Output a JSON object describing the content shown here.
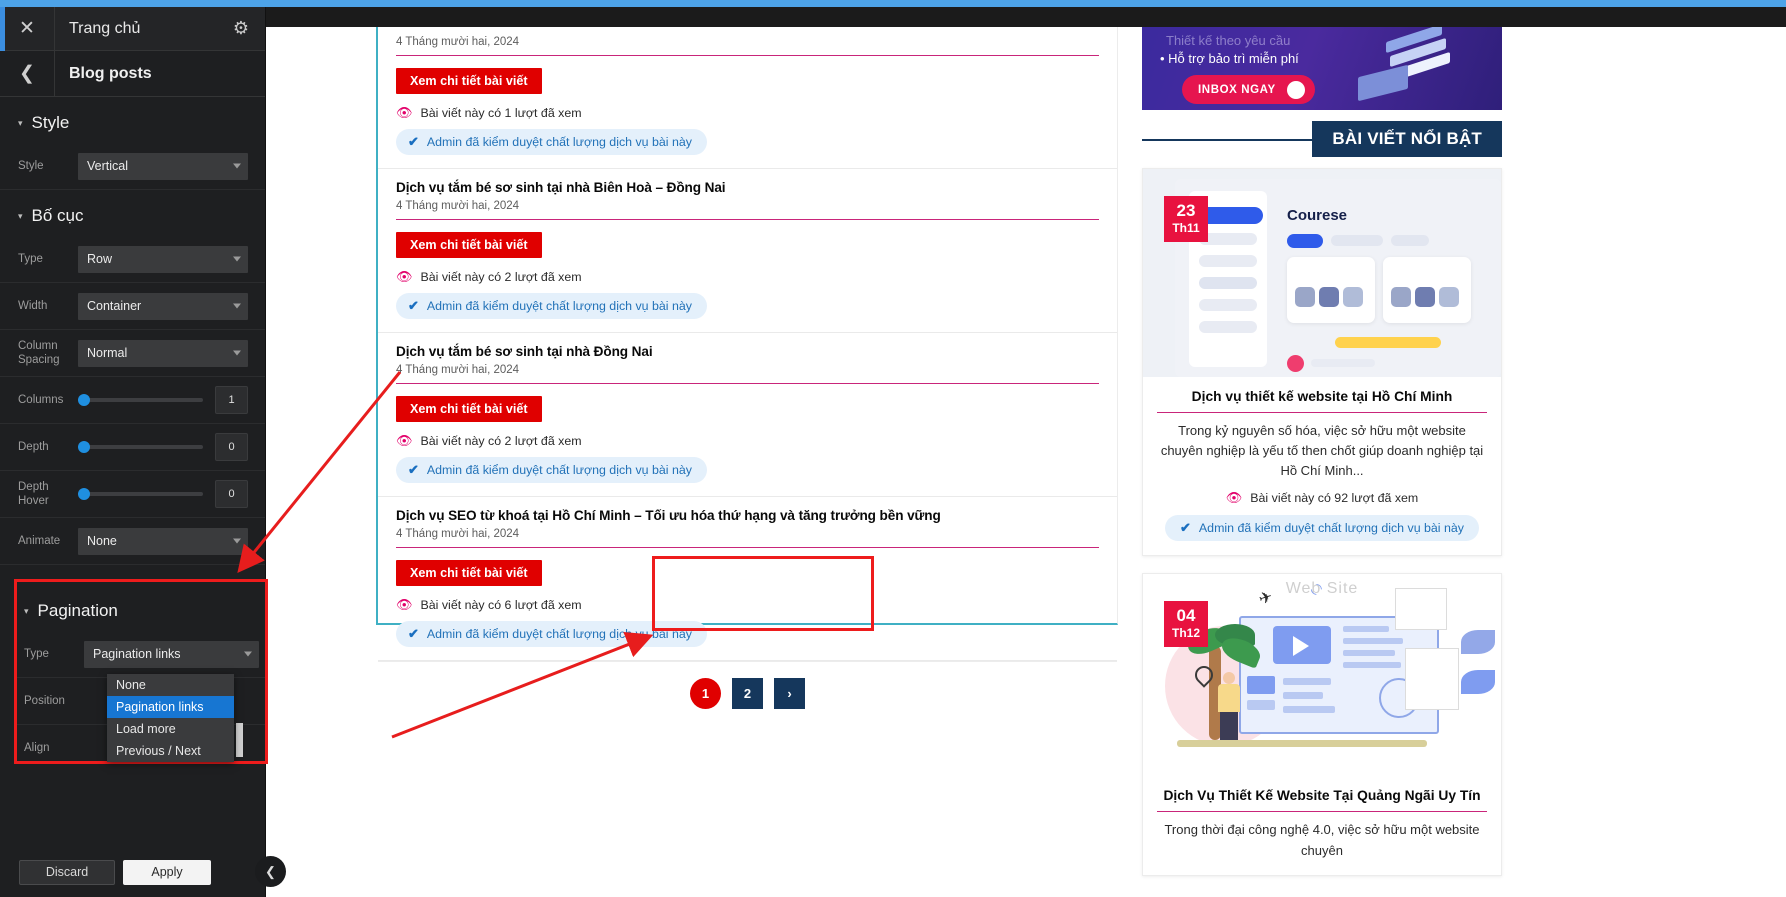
{
  "editor": {
    "close_icon": "✕",
    "home_title": "Trang chủ",
    "gear_icon": "⚙",
    "back_icon": "❮",
    "panel_title": "Blog posts",
    "sections": [
      {
        "name": "Style",
        "caret": "▾",
        "fields": [
          {
            "label": "Style",
            "type": "select",
            "value": "Vertical"
          }
        ]
      },
      {
        "name": "Bố cục",
        "caret": "▾",
        "fields": [
          {
            "label": "Type",
            "type": "select",
            "value": "Row"
          },
          {
            "label": "Width",
            "type": "select",
            "value": "Container"
          },
          {
            "label": "Column Spacing",
            "type": "select",
            "value": "Normal"
          },
          {
            "label": "Columns",
            "type": "slider",
            "value": "1"
          },
          {
            "label": "Depth",
            "type": "slider",
            "value": "0"
          },
          {
            "label": "Depth Hover",
            "type": "slider",
            "value": "0"
          },
          {
            "label": "Animate",
            "type": "select",
            "value": "None"
          }
        ]
      }
    ],
    "pagination": {
      "caret": "▾",
      "title": "Pagination",
      "type_label": "Type",
      "type_value": "Pagination links",
      "position_label": "Position",
      "align_label": "Align",
      "options": [
        {
          "label": "None",
          "selected": false
        },
        {
          "label": "Pagination links",
          "selected": true
        },
        {
          "label": "Load more",
          "selected": false
        },
        {
          "label": "Previous / Next",
          "selected": false
        }
      ]
    },
    "footer": {
      "discard": "Discard",
      "apply": "Apply",
      "collapse_icon": "❮"
    }
  },
  "content": {
    "posts": [
      {
        "title": "",
        "title_clipped": true,
        "date": "4 Tháng mười hai, 2024",
        "button": "Xem chi tiết bài viết",
        "views": "Bài viết này có 1 lượt đã xem",
        "admin": "Admin đã kiểm duyệt chất lượng dịch vụ bài này"
      },
      {
        "title": "Dịch vụ tắm bé sơ sinh tại nhà Biên Hoà – Đồng Nai",
        "title_clipped": false,
        "date": "4 Tháng mười hai, 2024",
        "button": "Xem chi tiết bài viết",
        "views": "Bài viết này có 2 lượt đã xem",
        "admin": "Admin đã kiểm duyệt chất lượng dịch vụ bài này"
      },
      {
        "title": "Dịch vụ tắm bé sơ sinh tại nhà Đồng Nai",
        "title_clipped": false,
        "date": "4 Tháng mười hai, 2024",
        "button": "Xem chi tiết bài viết",
        "views": "Bài viết này có 2 lượt đã xem",
        "admin": "Admin đã kiểm duyệt chất lượng dịch vụ bài này"
      },
      {
        "title": "Dịch vụ SEO từ khoá tại Hồ Chí Minh – Tối ưu hóa thứ hạng và tăng trưởng bền vững",
        "title_clipped": false,
        "date": "4 Tháng mười hai, 2024",
        "button": "Xem chi tiết bài viết",
        "views": "Bài viết này có 6 lượt đã xem",
        "admin": "Admin đã kiểm duyệt chất lượng dịch vụ bài này"
      }
    ],
    "pager": {
      "current": "1",
      "page2": "2",
      "next_icon": "›"
    },
    "eye_icon": "👁",
    "check_icon": "✔"
  },
  "rail": {
    "promo": {
      "line_faded": "Thiết kế theo yêu cầu",
      "bullet": "• Hỗ trợ bảo trì miễn phí",
      "cta": "INBOX NGAY",
      "cta_icon": "❯"
    },
    "featured_heading": "BÀI VIẾT NỔI BẬT",
    "cards": [
      {
        "date_day": "23",
        "date_month": "Th11",
        "art": "dashboard-mock",
        "mock_title": "Courese",
        "title": "Dịch vụ thiết kế website tại Hồ Chí Minh",
        "desc": "Trong kỷ nguyên số hóa, việc sở hữu một website chuyên nghiệp là yếu tố then chốt giúp doanh nghiệp tại Hồ Chí Minh...",
        "views": "Bài viết này có 92 lượt đã xem",
        "admin": "Admin đã kiểm duyệt chất lượng dịch vụ bài này"
      },
      {
        "date_day": "04",
        "date_month": "Th12",
        "art": "travel-illustration",
        "art_caption": "Web Site",
        "title": "Dịch Vụ Thiết Kế Website Tại Quảng Ngãi Uy Tín",
        "desc": "Trong thời đại công nghệ 4.0, việc sở hữu một website chuyên",
        "views": "",
        "admin": ""
      }
    ]
  },
  "colors": {
    "accent_red": "#e00000",
    "accent_blue": "#1f8fe0",
    "navy": "#15375c",
    "pink_rule": "#c9257a",
    "teal_border": "#3fb0c4",
    "highlight_red": "#ee1c1c"
  }
}
